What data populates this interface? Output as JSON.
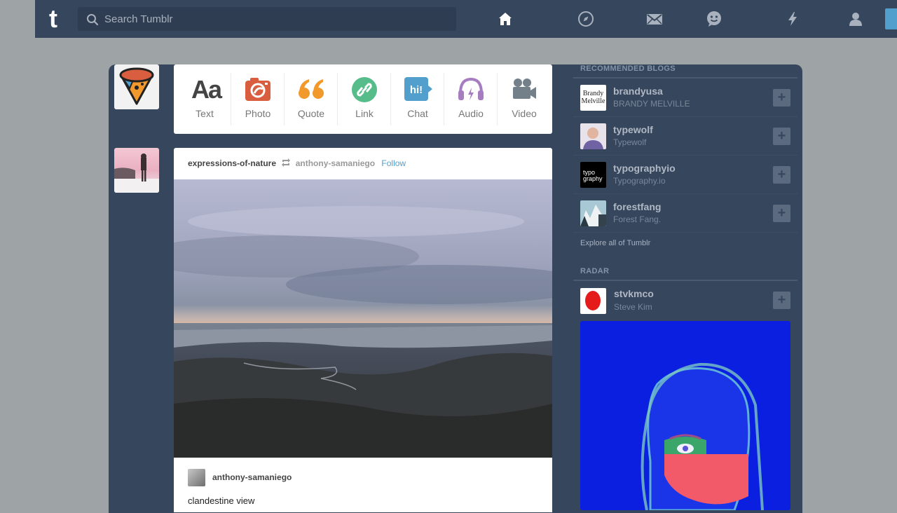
{
  "topbar": {
    "logo": "t",
    "search_placeholder": "Search Tumblr",
    "icons": [
      "home-icon",
      "explore-icon",
      "inbox-icon",
      "messaging-icon",
      "activity-icon",
      "account-icon"
    ],
    "accent": "#529ecc",
    "background": "#36465d"
  },
  "composer": {
    "types": [
      {
        "label": "Text",
        "icon": "text-icon",
        "color": "#444444"
      },
      {
        "label": "Photo",
        "icon": "camera-icon",
        "color": "#d95e40"
      },
      {
        "label": "Quote",
        "icon": "quote-icon",
        "color": "#f2992e"
      },
      {
        "label": "Link",
        "icon": "link-icon",
        "color": "#56bc8a"
      },
      {
        "label": "Chat",
        "icon": "chat-icon",
        "color": "#529ecc"
      },
      {
        "label": "Audio",
        "icon": "headphones-icon",
        "color": "#a77dc2"
      },
      {
        "label": "Video",
        "icon": "video-camera-icon",
        "color": "#748089"
      }
    ],
    "text_glyph": "Aa",
    "chat_glyph": "hi!"
  },
  "post": {
    "blog": "expressions-of-nature",
    "reblogged_from": "anthony-samaniego",
    "follow_label": "Follow",
    "source_blog": "anthony-samaniego",
    "caption": "clandestine view"
  },
  "sidebar": {
    "recommended_heading": "RECOMMENDED BLOGS",
    "blogs": [
      {
        "name": "brandyusa",
        "title": "BRANDY MELVILLE",
        "thumb_text": "Brandy Melville"
      },
      {
        "name": "typewolf",
        "title": "Typewolf",
        "thumb_text": ""
      },
      {
        "name": "typographyio",
        "title": "Typography.io",
        "thumb_text": "typo graphy"
      },
      {
        "name": "forestfang",
        "title": "Forest Fang.",
        "thumb_text": ""
      }
    ],
    "explore_label": "Explore all of Tumblr",
    "radar_heading": "RADAR",
    "radar": {
      "name": "stvkmco",
      "title": "Steve Kim"
    },
    "plus_label": "+"
  }
}
